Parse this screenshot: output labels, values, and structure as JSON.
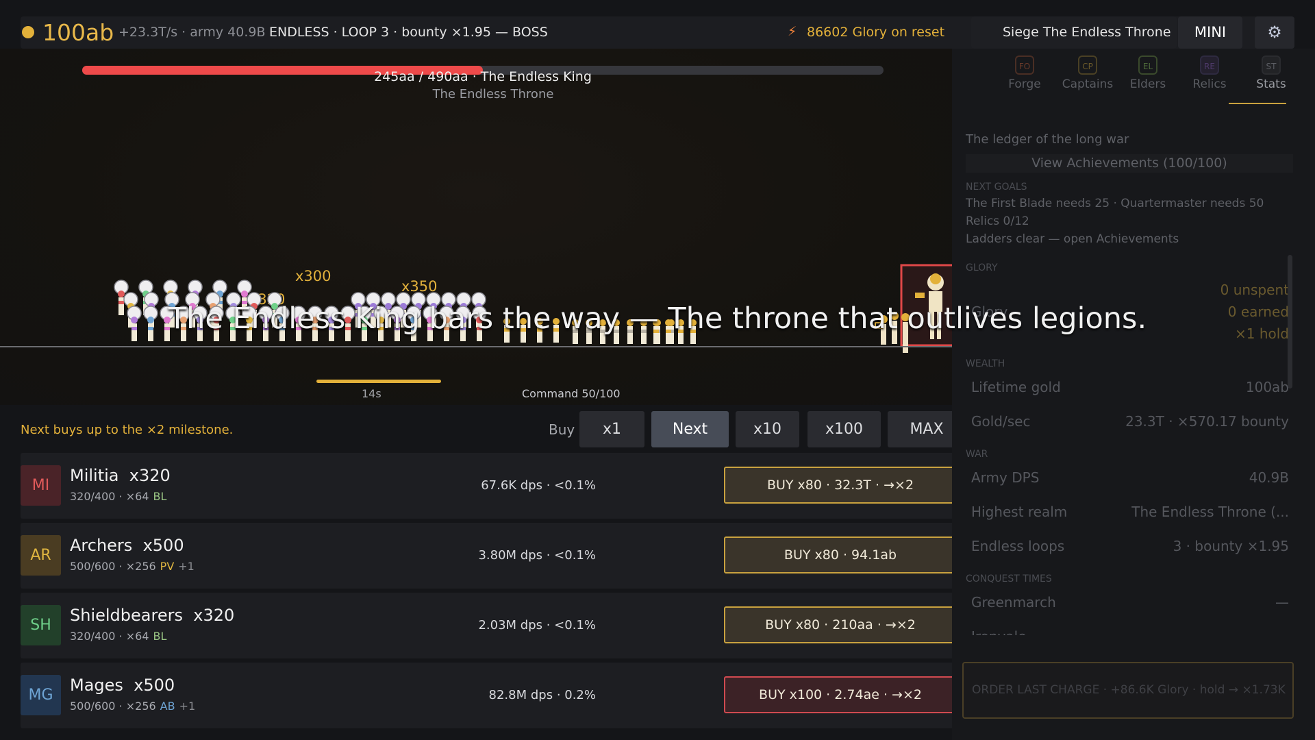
{
  "header": {
    "gold": "100ab",
    "rate_info": "+23.3T/s · army 40.9B",
    "status": "ENDLESS · LOOP 3 · bounty ×1.95 — BOSS",
    "glory_on_reset": "86602 Glory on reset",
    "siege_button": "Siege The Endless Throne",
    "mini_button": "MINI"
  },
  "boss": {
    "hp_label": "245aa / 490aa · The Endless King",
    "hp_fraction": 0.5,
    "realm": "The Endless Throne"
  },
  "battlefield": {
    "stack_labels": [
      "x300",
      "x320",
      "x350"
    ],
    "banner": "The Endless King bars the way — The throne that outlives legions.",
    "charge_timer": "14s",
    "command": "Command 50/100"
  },
  "buy_controls": {
    "milestone_note": "Next buys up to the ×2 milestone.",
    "label": "Buy",
    "options": [
      "x1",
      "Next",
      "x10",
      "x100",
      "MAX"
    ],
    "selected": "Next"
  },
  "units": [
    {
      "abbr": "MI",
      "name": "Militia",
      "count": "x320",
      "meta": "320/400 · ×64",
      "tags": [
        "BL"
      ],
      "extra": "",
      "dps": "67.6K dps · <0.1%",
      "buy": "BUY x80 · 32.3T · →×2",
      "style": "ok"
    },
    {
      "abbr": "AR",
      "name": "Archers",
      "count": "x500",
      "meta": "500/600 · ×256",
      "tags": [
        "PV"
      ],
      "extra": "+1",
      "dps": "3.80M dps · <0.1%",
      "buy": "BUY x80 · 94.1ab",
      "style": "ok"
    },
    {
      "abbr": "SH",
      "name": "Shieldbearers",
      "count": "x320",
      "meta": "320/400 · ×64",
      "tags": [
        "BL"
      ],
      "extra": "",
      "dps": "2.03M dps · <0.1%",
      "buy": "BUY x80 · 210aa · →×2",
      "style": "ok"
    },
    {
      "abbr": "MG",
      "name": "Mages",
      "count": "x500",
      "meta": "500/600 · ×256",
      "tags": [
        "AB"
      ],
      "extra": "+1",
      "dps": "82.8M dps · 0.2%",
      "buy": "BUY x100 · 2.74ae · →×2",
      "style": "danger"
    }
  ],
  "panel": {
    "tabs": [
      {
        "abbr": "FO",
        "label": "Forge"
      },
      {
        "abbr": "CP",
        "label": "Captains"
      },
      {
        "abbr": "EL",
        "label": "Elders"
      },
      {
        "abbr": "RE",
        "label": "Relics"
      },
      {
        "abbr": "ST",
        "label": "Stats"
      }
    ],
    "active_tab": "Stats",
    "ledger_title": "The ledger of the long war",
    "achievements_button": "View Achievements (100/100)",
    "next_goals_heading": "NEXT GOALS",
    "goals": [
      "The First Blade needs 25 · Quartermaster needs 50",
      "Relics 0/12",
      "Ladders clear — open Achievements"
    ],
    "glory_heading": "GLORY",
    "glory_label": "Glory",
    "glory_values": [
      "0 unspent",
      "0 earned",
      "×1 hold"
    ],
    "wealth_heading": "WEALTH",
    "wealth": [
      {
        "label": "Lifetime gold",
        "value": "100ab"
      },
      {
        "label": "Gold/sec",
        "value": "23.3T · ×570.17 bounty"
      }
    ],
    "war_heading": "WAR",
    "war": [
      {
        "label": "Army DPS",
        "value": "40.9B"
      },
      {
        "label": "Highest realm",
        "value": "The Endless Throne (..."
      },
      {
        "label": "Endless loops",
        "value": "3 · bounty ×1.95"
      }
    ],
    "conquest_heading": "CONQUEST TIMES",
    "conquest": [
      {
        "label": "Greenmarch",
        "value": "—"
      },
      {
        "label": "Ironvale",
        "value": ""
      }
    ],
    "last_charge_button": "ORDER LAST CHARGE · +86.6K Glory · hold → ×1.73K"
  },
  "colors": {
    "accent_gold": "#e3b13a",
    "boss_hp": "#ee4a4a",
    "danger": "#d04a50"
  }
}
